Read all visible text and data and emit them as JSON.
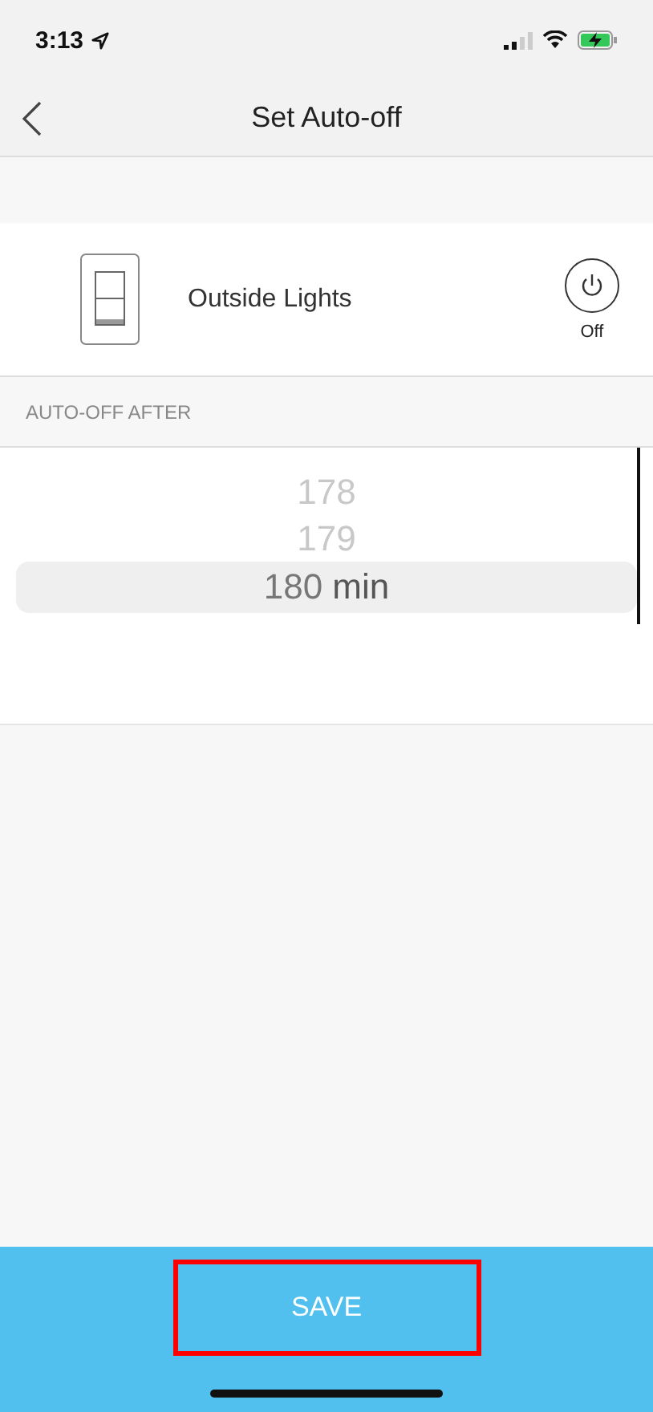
{
  "status_bar": {
    "time": "3:13"
  },
  "nav": {
    "title": "Set Auto-off"
  },
  "device": {
    "name": "Outside Lights",
    "on": false,
    "state_label": "Off"
  },
  "section": {
    "title": "AUTO-OFF AFTER"
  },
  "picker": {
    "unit": "min",
    "options": [
      {
        "label": "178",
        "selected": false
      },
      {
        "label": "179",
        "selected": false
      },
      {
        "label": "180",
        "selected": true
      }
    ]
  },
  "save_button": {
    "label": "SAVE",
    "highlighted": true
  }
}
